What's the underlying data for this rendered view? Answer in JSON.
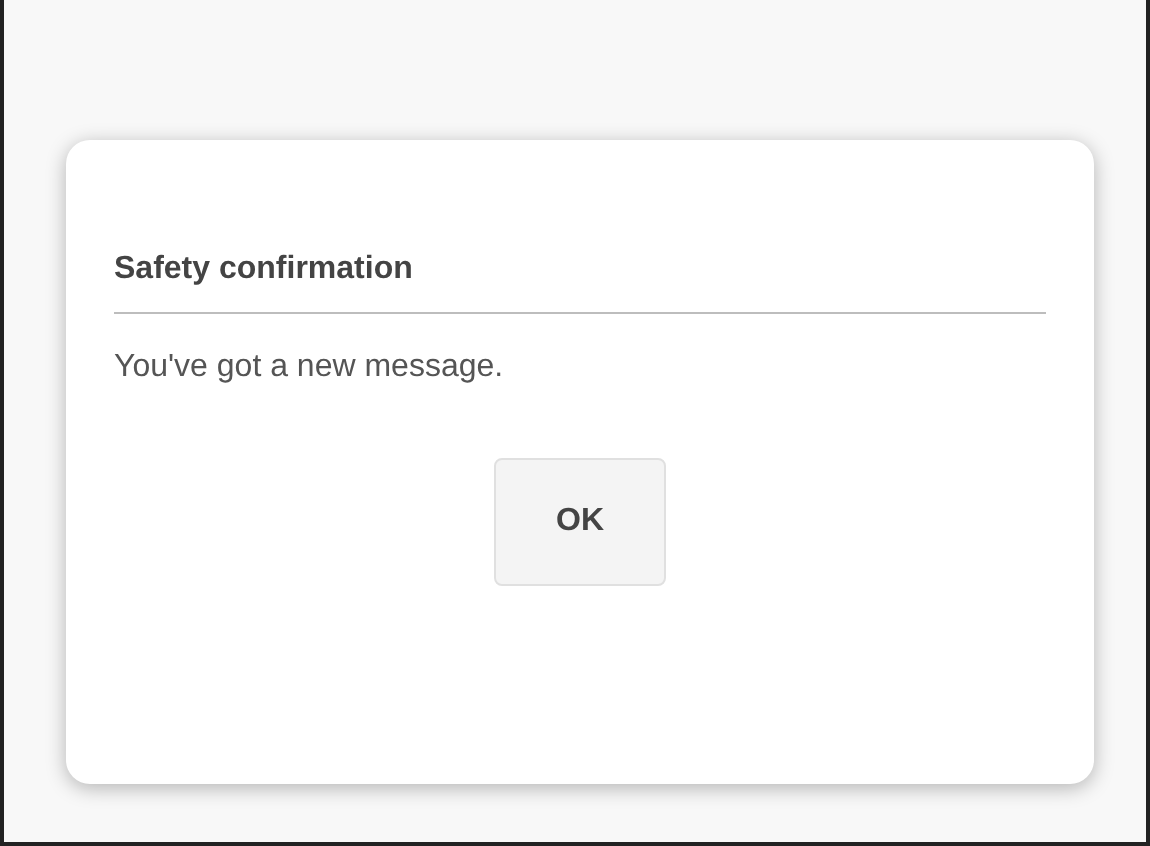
{
  "dialog": {
    "title": "Safety confirmation",
    "message": "You've got a new message.",
    "buttons": [
      "OK"
    ]
  }
}
